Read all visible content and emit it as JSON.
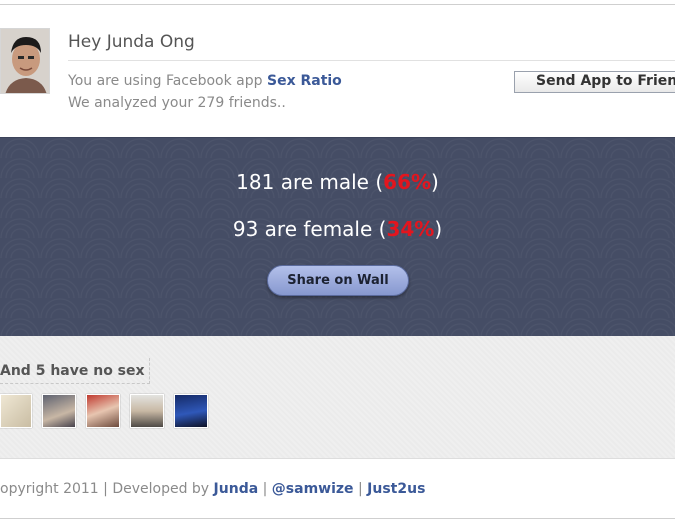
{
  "header": {
    "greeting": "Hey Junda Ong",
    "using_prefix": "You are using Facebook app ",
    "app_name": "Sex Ratio",
    "analyzed": "We analyzed your 279 friends..",
    "send_button": "Send App to Friends"
  },
  "results": {
    "male_text": "181 are male (",
    "male_pct": "66%",
    "male_close": ")",
    "female_text": "93 are female (",
    "female_pct": "34%",
    "female_close": ")",
    "share_button": "Share on Wall"
  },
  "nosex": {
    "label": "And 5 have no sex",
    "thumbnail_count": 5
  },
  "footer": {
    "prefix": "opyright 2011 | Developed by ",
    "link1": "Junda",
    "sep1": " | ",
    "link2": "@samwize",
    "sep2": " | ",
    "link3": "Just2us"
  },
  "colors": {
    "link": "#3b5998",
    "band": "#454d65",
    "percent": "#e3151e",
    "share_button": "#8798cf"
  }
}
